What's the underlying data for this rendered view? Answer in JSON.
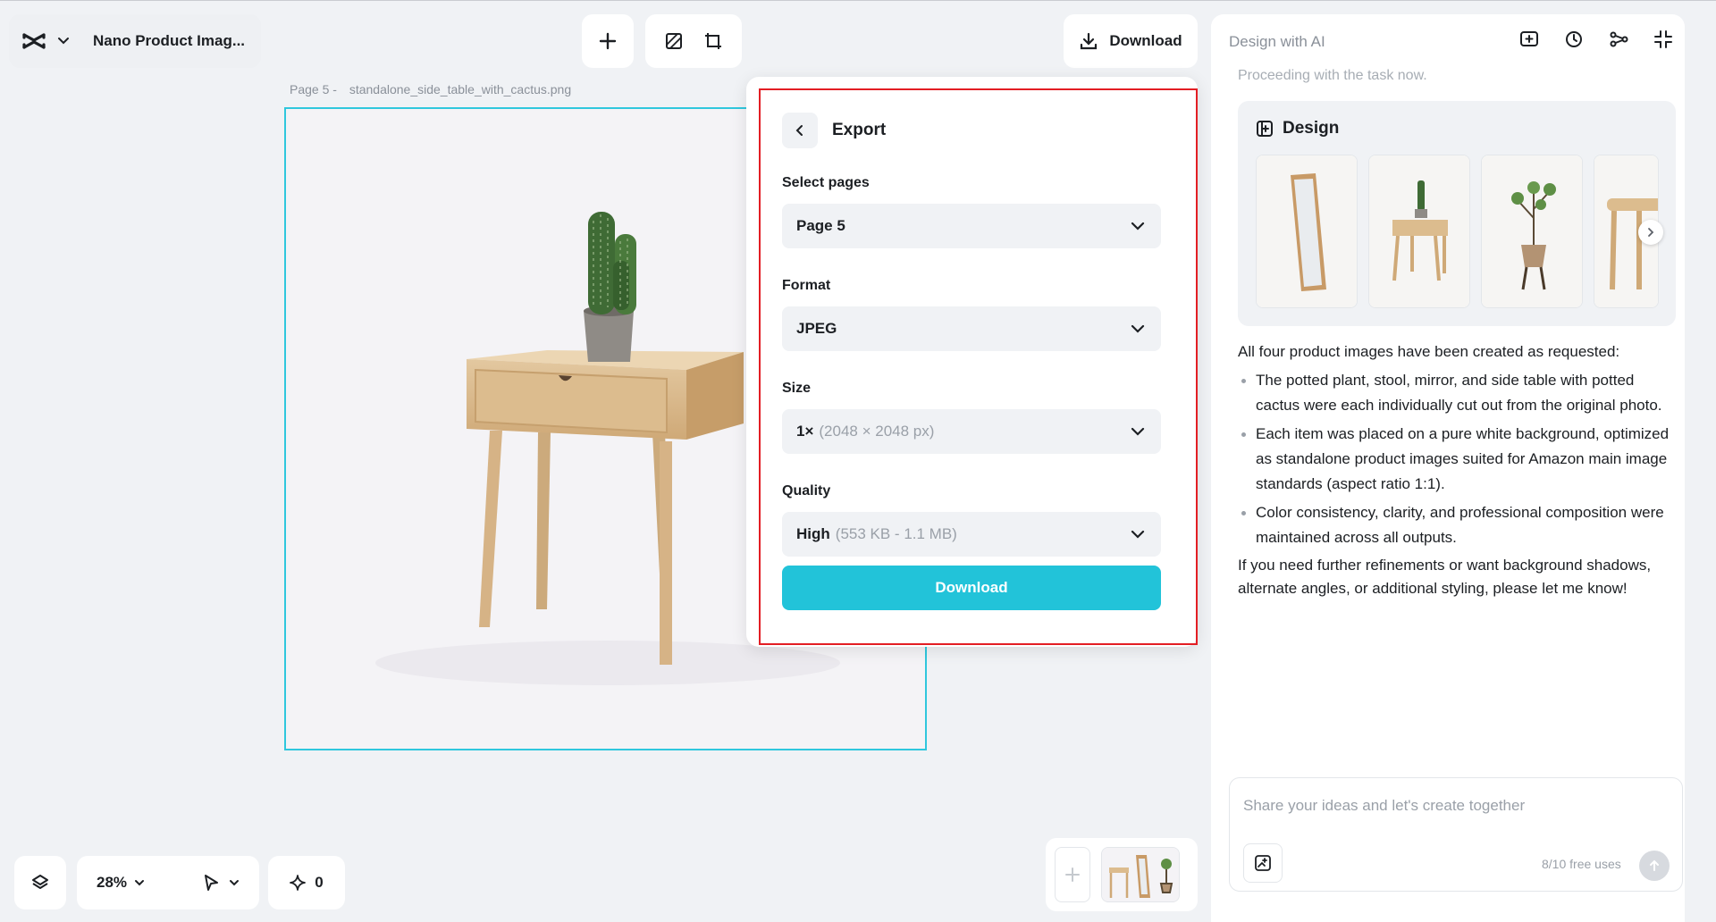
{
  "project": {
    "title": "Nano Product Imag..."
  },
  "toolbar": {
    "download_label": "Download"
  },
  "canvas": {
    "page_label": "Page 5 -",
    "file_name": "standalone_side_table_with_cactus.png"
  },
  "export": {
    "title": "Export",
    "select_pages_label": "Select pages",
    "select_pages_value": "Page 5",
    "format_label": "Format",
    "format_value": "JPEG",
    "size_label": "Size",
    "size_value": "1×",
    "size_detail": "(2048 × 2048 px)",
    "quality_label": "Quality",
    "quality_value": "High",
    "quality_detail": "(553 KB - 1.1 MB)",
    "download_label": "Download"
  },
  "ai_panel": {
    "title": "Design with AI",
    "faded_text": "Proceeding with the task now.",
    "design_title": "Design",
    "intro": "All four product images have been created as requested:",
    "bullets": [
      "The potted plant, stool, mirror, and side table with potted cactus were each individually cut out from the original photo.",
      "Each item was placed on a pure white background, optimized as standalone product images suited for Amazon main image standards (aspect ratio 1:1).",
      "Color consistency, clarity, and professional composition were maintained across all outputs."
    ],
    "outro": "If you need further refinements or want background shadows, alternate angles, or additional styling, please let me know!",
    "input_placeholder": "Share your ideas and let's create together",
    "free_uses": "8/10 free uses"
  },
  "bottom": {
    "zoom": "28%",
    "credits": "0"
  },
  "colors": {
    "accent": "#22c3d9",
    "highlight": "#e31e24",
    "selection": "#2fc7dd"
  }
}
